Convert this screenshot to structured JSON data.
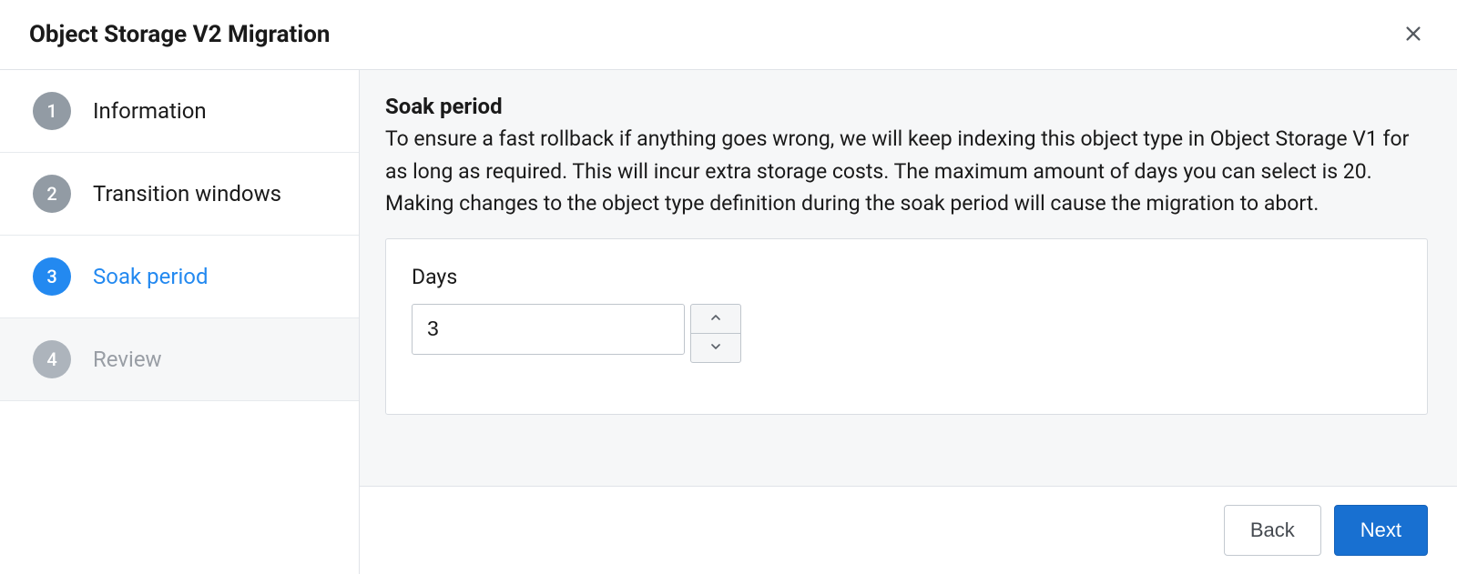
{
  "header": {
    "title": "Object Storage V2 Migration"
  },
  "sidebar": {
    "steps": [
      {
        "num": "1",
        "label": "Information"
      },
      {
        "num": "2",
        "label": "Transition windows"
      },
      {
        "num": "3",
        "label": "Soak period"
      },
      {
        "num": "4",
        "label": "Review"
      }
    ]
  },
  "main": {
    "section_title": "Soak period",
    "section_desc": "To ensure a fast rollback if anything goes wrong, we will keep indexing this object type in Object Storage V1 for as long as required. This will incur extra storage costs. The maximum amount of days you can select is 20. Making changes to the object type definition during the soak period will cause the migration to abort.",
    "days_label": "Days",
    "days_value": "3"
  },
  "footer": {
    "back_label": "Back",
    "next_label": "Next"
  }
}
